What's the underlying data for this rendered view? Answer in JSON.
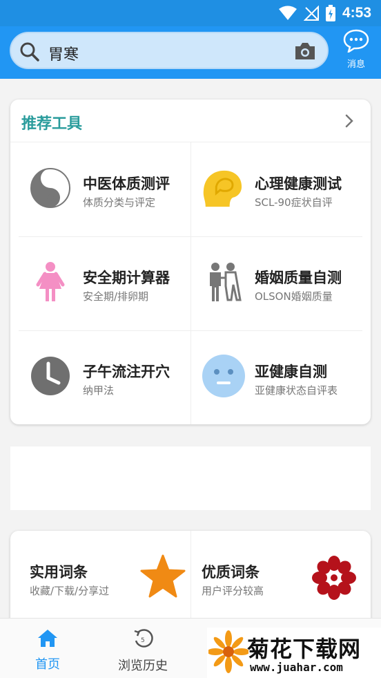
{
  "status_bar": {
    "time": "4:53"
  },
  "search": {
    "query": "胃寒"
  },
  "messages": {
    "label": "消息"
  },
  "tools": {
    "title": "推荐工具",
    "items": [
      {
        "title": "中医体质测评",
        "subtitle": "体质分类与评定",
        "icon": "yin-yang-icon"
      },
      {
        "title": "心理健康测试",
        "subtitle": "SCL-90症状自评",
        "icon": "head-profile-icon"
      },
      {
        "title": "安全期计算器",
        "subtitle": "安全期/排卵期",
        "icon": "woman-icon"
      },
      {
        "title": "婚姻质量自测",
        "subtitle": "OLSON婚姻质量",
        "icon": "couple-icon"
      },
      {
        "title": "子午流注开穴",
        "subtitle": "纳甲法",
        "icon": "clock-icon"
      },
      {
        "title": "亚健康自测",
        "subtitle": "亚健康状态自评表",
        "icon": "neutral-face-icon"
      }
    ]
  },
  "entries": [
    {
      "title": "实用词条",
      "subtitle": "收藏/下载/分享过",
      "icon": "star-icon"
    },
    {
      "title": "优质词条",
      "subtitle": "用户评分较高",
      "icon": "flower-icon"
    }
  ],
  "tabs": [
    {
      "label": "首页",
      "icon": "home-icon",
      "active": true
    },
    {
      "label": "浏览历史",
      "icon": "history-icon",
      "active": false
    }
  ],
  "watermark": {
    "text": "菊花下载网",
    "url": "www.juahar.com"
  },
  "colors": {
    "primary": "#2196f3",
    "title_teal": "#2a9c9c",
    "star": "#f08a14",
    "flower": "#b5121b",
    "pink": "#f48fc4",
    "face": "#a9d2f5",
    "head": "#f6c526"
  }
}
